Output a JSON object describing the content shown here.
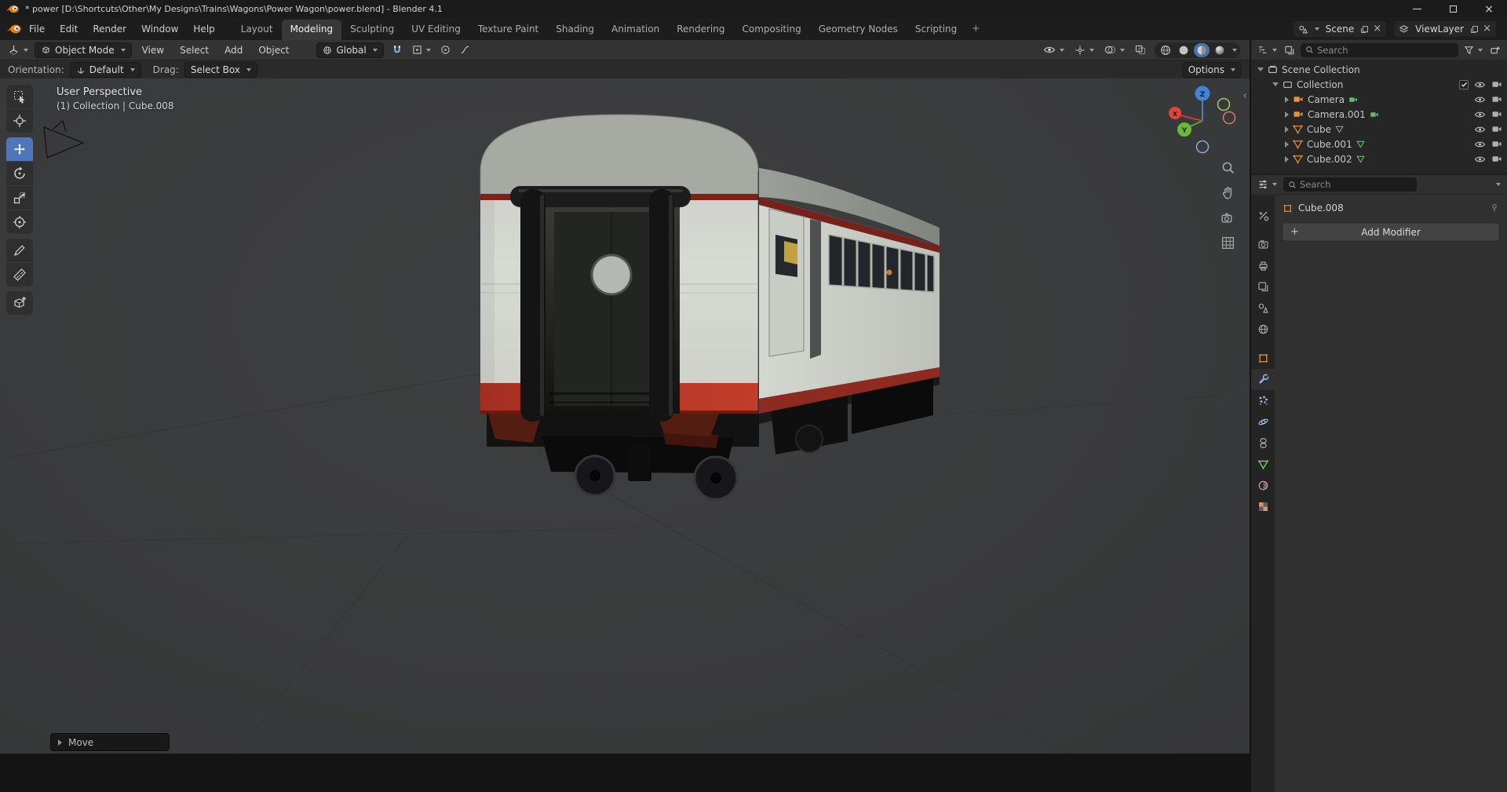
{
  "titlebar": {
    "title": "* power [D:\\Shortcuts\\Other\\My Designs\\Trains\\Wagons\\Power Wagon\\power.blend] - Blender 4.1"
  },
  "topbar": {
    "menus": [
      "File",
      "Edit",
      "Render",
      "Window",
      "Help"
    ],
    "workspaces": [
      "Layout",
      "Modeling",
      "Sculpting",
      "UV Editing",
      "Texture Paint",
      "Shading",
      "Animation",
      "Rendering",
      "Compositing",
      "Geometry Nodes",
      "Scripting"
    ],
    "active_workspace": "Modeling",
    "add_workspace": "+",
    "scene": {
      "label": "Scene"
    },
    "view_layer": {
      "label": "ViewLayer"
    }
  },
  "viewport": {
    "header": {
      "mode": "Object Mode",
      "menus": [
        "View",
        "Select",
        "Add",
        "Object"
      ],
      "orientation": "Global"
    },
    "tool_settings": {
      "orientation_label": "Orientation:",
      "orientation_value": "Default",
      "drag_label": "Drag:",
      "drag_value": "Select Box",
      "options": "Options"
    },
    "overlay": {
      "view_label": "User Perspective",
      "context_label": "(1) Collection | Cube.008"
    },
    "gizmo_axes": {
      "x": "X",
      "y": "Y",
      "z": "Z"
    },
    "operator_panel": {
      "label": "Move"
    },
    "tools": [
      "select-box",
      "cursor",
      "move",
      "rotate",
      "scale",
      "transform",
      "annotate",
      "measure",
      "add-cube"
    ],
    "active_tool": "move"
  },
  "outliner": {
    "search_placeholder": "Search",
    "scene_collection_label": "Scene Collection",
    "collection_label": "Collection",
    "objects": [
      {
        "name": "Camera",
        "type": "camera"
      },
      {
        "name": "Camera.001",
        "type": "camera"
      },
      {
        "name": "Cube",
        "type": "mesh"
      },
      {
        "name": "Cube.001",
        "type": "mesh"
      },
      {
        "name": "Cube.002",
        "type": "mesh"
      }
    ]
  },
  "properties": {
    "search_placeholder": "Search",
    "active_object": "Cube.008",
    "add_modifier_label": "Add Modifier",
    "tabs": [
      "tool",
      "render",
      "output",
      "view-layer",
      "scene",
      "world",
      "object",
      "modifiers",
      "particles",
      "physics",
      "constraints",
      "object-data",
      "material",
      "texture"
    ],
    "active_tab": "modifiers"
  },
  "colors": {
    "accent_blue": "#4772b3",
    "object_orange": "#e8913a",
    "data_green": "#66bb6a",
    "axis_x_red": "#e0443d",
    "axis_y_green": "#6fb63c",
    "axis_z_blue": "#3f84d6",
    "train_body": "#d3d5cf",
    "train_red_band": "#b83527",
    "train_stripe_red": "#7c221b"
  }
}
